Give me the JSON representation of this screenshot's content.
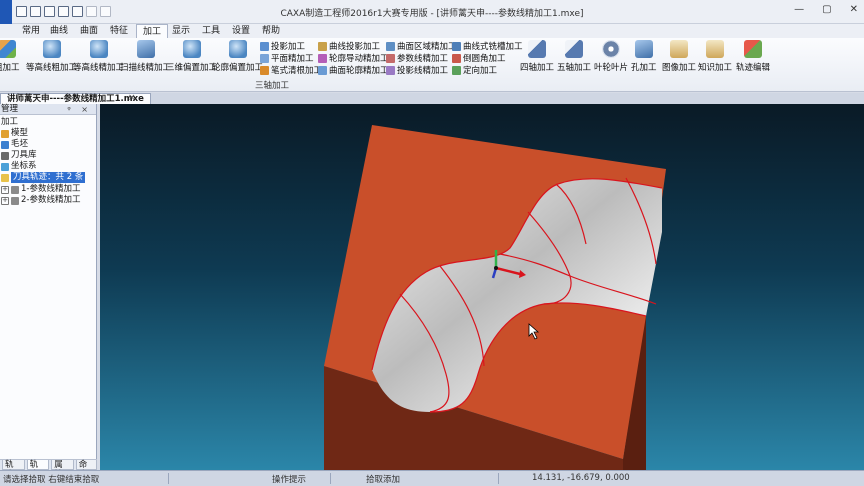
{
  "window": {
    "title": "CAXA制造工程师2016r1大赛专用版 - [讲师蓠天申----参数线精加工1.mxe]",
    "controls": [
      "—",
      "▢",
      "✕"
    ]
  },
  "menu": {
    "tabs": [
      {
        "label": "常用"
      },
      {
        "label": "曲线"
      },
      {
        "label": "曲面"
      },
      {
        "label": "特征"
      },
      {
        "label": "加工"
      },
      {
        "label": "显示"
      },
      {
        "label": "工具"
      },
      {
        "label": "设置"
      },
      {
        "label": "帮助"
      }
    ],
    "active_tab": "加工"
  },
  "ribbon": {
    "large_buttons": [
      {
        "label": "粗加工"
      },
      {
        "label": "等高线粗加工"
      },
      {
        "label": "等高线精加工"
      },
      {
        "label": "扫描线精加工"
      },
      {
        "label": "三维偏置加工"
      },
      {
        "label": "轮廓偏置加工"
      },
      {
        "label": "四轴加工"
      },
      {
        "label": "五轴加工"
      },
      {
        "label": "叶轮叶片"
      },
      {
        "label": "孔加工"
      },
      {
        "label": "图像加工"
      },
      {
        "label": "知识加工"
      },
      {
        "label": "轨迹编辑"
      }
    ],
    "small_buttons": [
      {
        "label": "投影加工"
      },
      {
        "label": "平面精加工"
      },
      {
        "label": "笔式清根加工"
      },
      {
        "label": "曲线投影加工"
      },
      {
        "label": "轮廓导动精加工"
      },
      {
        "label": "曲面轮廓精加工"
      },
      {
        "label": "曲面区域精加工"
      },
      {
        "label": "参数线精加工"
      },
      {
        "label": "投影线精加工"
      },
      {
        "label": "曲线式铣槽加工"
      },
      {
        "label": "倒圆角加工"
      },
      {
        "label": "定向加工"
      }
    ],
    "group_label": "三轴加工"
  },
  "document_tab": {
    "label": "讲师蓠天申----参数线精加工1.mxe",
    "close": "×"
  },
  "panel": {
    "title": "管理",
    "controls": "ᵠ ×",
    "root": "加工",
    "items": [
      {
        "label": "模型",
        "icon": "model-icon"
      },
      {
        "label": "毛坯",
        "icon": "blank-icon"
      },
      {
        "label": "刀具库",
        "icon": "tool-library-icon"
      },
      {
        "label": "坐标系",
        "icon": "coordinate-icon"
      }
    ],
    "selected": "刀具轨迹：共 2 条",
    "children": [
      {
        "label": "1-参数线精加工"
      },
      {
        "label": "2-参数线精加工"
      }
    ],
    "tabs": [
      "轨迹...",
      "轨迹...",
      "属性...",
      "命令行"
    ]
  },
  "status": {
    "left": "请选择拾取 右键结束拾取",
    "mid1": "操作提示",
    "mid2": "拾取添加",
    "coords": "14.131, -16.679, 0.000"
  },
  "colors": {
    "accent": "#2f6fd0",
    "part_top": "#c94f2a",
    "part_side": "#7a2d18",
    "toolpath": "#d9141d",
    "viewport_top": "#0a1a26",
    "viewport_bottom": "#2b86a9"
  }
}
